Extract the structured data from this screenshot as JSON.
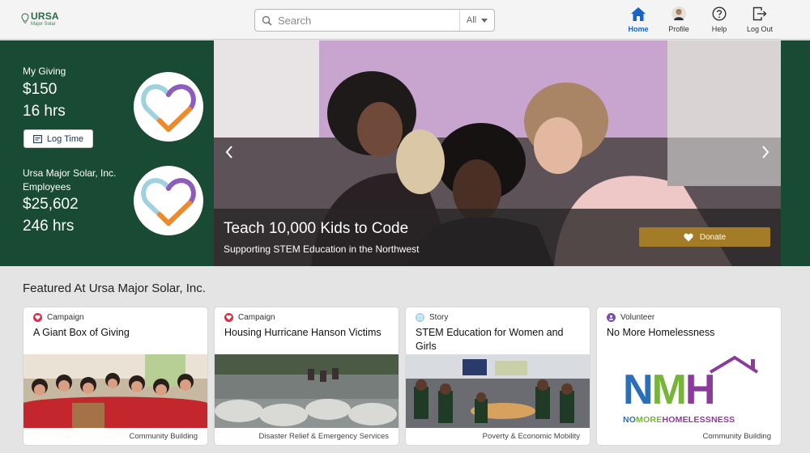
{
  "logo": {
    "name": "URSA",
    "sub": "Major Solar"
  },
  "search": {
    "placeholder": "Search",
    "scope": "All"
  },
  "nav": [
    {
      "label": "Home",
      "icon": "home-icon",
      "active": true
    },
    {
      "label": "Profile",
      "icon": "avatar-icon",
      "active": false
    },
    {
      "label": "Help",
      "icon": "help-icon",
      "active": false
    },
    {
      "label": "Log Out",
      "icon": "logout-icon",
      "active": false
    }
  ],
  "giving": {
    "my_label": "My Giving",
    "my_amount": "$150",
    "my_hours": "16 hrs",
    "log_time": "Log Time",
    "org_label_1": "Ursa Major Solar, Inc.",
    "org_label_2": "Employees",
    "org_amount": "$25,602",
    "org_hours": "246 hrs"
  },
  "hero": {
    "title": "Teach 10,000 Kids to Code",
    "subtitle": "Supporting STEM Education in the Northwest",
    "donate": "Donate"
  },
  "featured": {
    "title": "Featured At Ursa Major Solar, Inc.",
    "cards": [
      {
        "type": "Campaign",
        "title": "A Giant Box of Giving",
        "category": "Community Building",
        "type_color": "#e8283f"
      },
      {
        "type": "Campaign",
        "title": "Housing Hurricane Hanson Victims",
        "category": "Disaster Relief & Emergency Services",
        "type_color": "#e8283f"
      },
      {
        "type": "Story",
        "title": "STEM Education for Women and Girls",
        "category": "Poverty & Economic Mobility",
        "type_color": "#9fd2ec"
      },
      {
        "type": "Volunteer",
        "title": "No More Homelessness",
        "category": "Community Building",
        "type_color": "#7a4fb2"
      }
    ],
    "nmh_logo": {
      "letters": "NMH",
      "tagline": "NOMOREHOMELESSNESS"
    }
  },
  "colors": {
    "brand_green": "#184a34",
    "donate_gold": "#a47b26",
    "active_blue": "#1a63c4"
  }
}
